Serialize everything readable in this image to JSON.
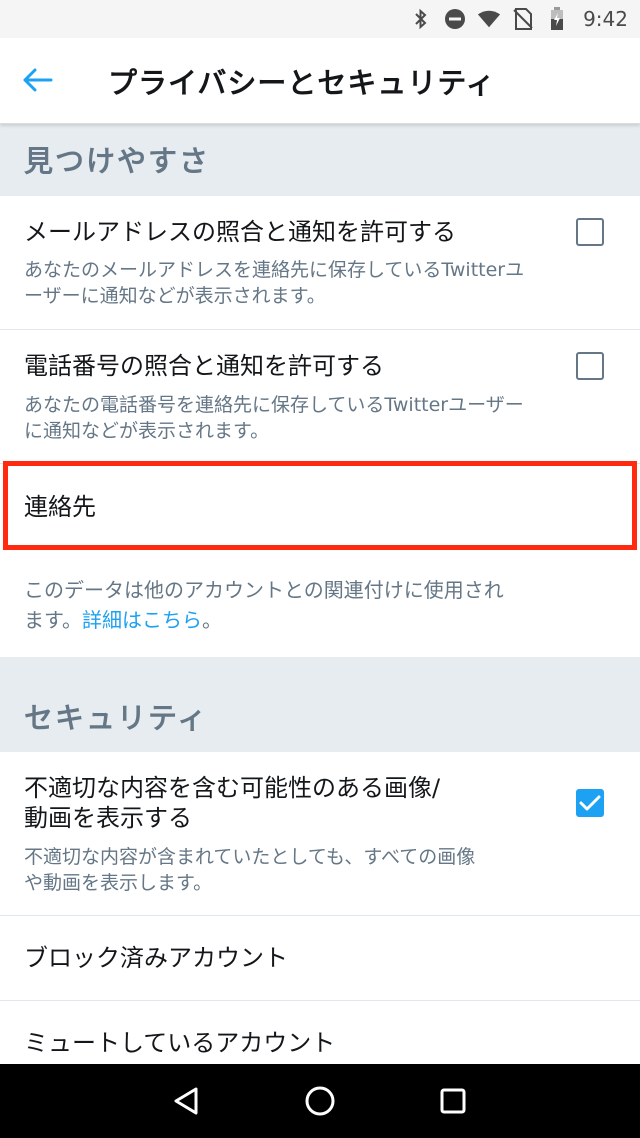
{
  "status_bar": {
    "time": "9:42",
    "icons": [
      "bluetooth-icon",
      "do-not-disturb-icon",
      "wifi-icon",
      "no-sim-icon",
      "battery-icon"
    ]
  },
  "app_bar": {
    "title": "プライバシーとセキュリティ",
    "back_icon": "arrow-left-icon"
  },
  "discoverability": {
    "header": "見つけやすさ",
    "email_match": {
      "title": "メールアドレスの照合と通知を許可する",
      "desc_line1": "あなたのメールアドレスを連絡先に保存しているTwitterユ",
      "desc_line2": "ーザーに通知などが表示されます。",
      "checked": false
    },
    "phone_match": {
      "title": "電話番号の照合と通知を許可する",
      "desc_line1": "あなたの電話番号を連絡先に保存しているTwitterユーザー",
      "desc_line2": "に通知などが表示されます。",
      "checked": false
    },
    "contacts": {
      "title": "連絡先"
    },
    "info": {
      "line1": "このデータは他のアカウントとの関連付けに使用され",
      "line2_prefix": "ます。",
      "link": "詳細はこちら",
      "line2_suffix": "。"
    }
  },
  "security": {
    "header": "セキュリティ",
    "sensitive_media": {
      "title_line1": "不適切な内容を含む可能性のある画像/",
      "title_line2": "動画を表示する",
      "desc_line1": "不適切な内容が含まれていたとしても、すべての画像",
      "desc_line2": "や動画を表示します。",
      "checked": true
    },
    "blocked_accounts": "ブロック済みアカウント",
    "muted_accounts": "ミュートしているアカウント"
  },
  "colors": {
    "accent": "#1da1f2",
    "highlight": "#ff2a10",
    "section_bg": "#e6ecf0",
    "secondary_text": "#657786"
  },
  "nav_bar": {
    "icons": [
      "back-triangle-icon",
      "home-circle-icon",
      "recents-square-icon"
    ]
  }
}
